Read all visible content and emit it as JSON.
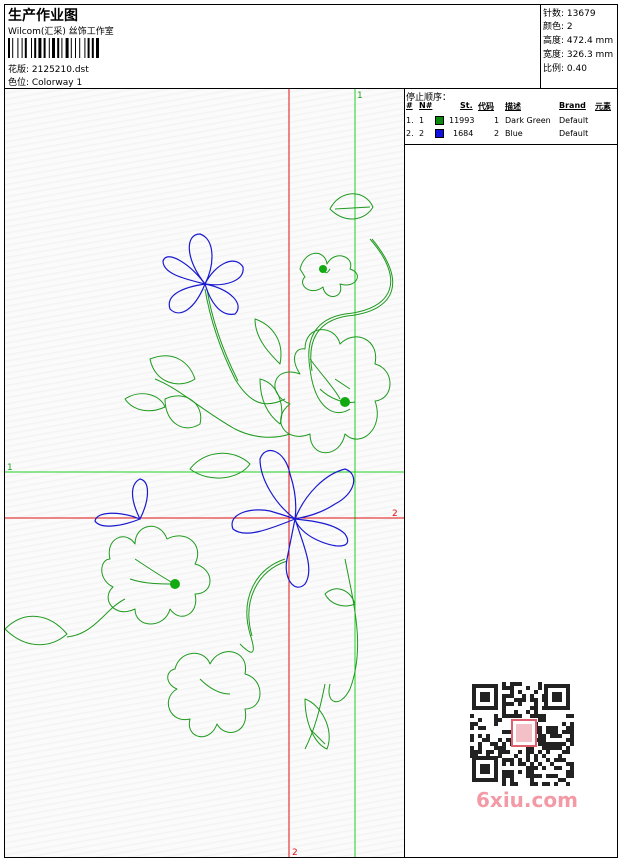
{
  "header": {
    "title": "生产作业图",
    "company": "Wilcom(汇采) 丝饰工作室",
    "design_label": "花版: 2125210.dst",
    "colorway_label": "色位:  Colorway 1"
  },
  "stats": [
    {
      "label": "针数",
      "value": "13679"
    },
    {
      "label": "颜色",
      "value": "2"
    },
    {
      "label": "高度",
      "value": "472.4 mm"
    },
    {
      "label": "宽度",
      "value": "326.3 mm"
    },
    {
      "label": "比例",
      "value": "0.40"
    }
  ],
  "stop_sequence": {
    "title": "停止顺序：",
    "columns": [
      "#",
      "N#",
      "St.",
      "代码",
      "描述",
      "Brand",
      "元素"
    ],
    "rows": [
      {
        "index": "1.",
        "n": "1",
        "stitches": "11993",
        "code": "1",
        "description": "Dark Green",
        "brand": "Default",
        "color": "#0a8a0a"
      },
      {
        "index": "2.",
        "n": "2",
        "stitches": "1684",
        "code": "2",
        "description": "Blue",
        "brand": "Default",
        "color": "#1010e0"
      }
    ]
  },
  "guides": {
    "green_vertical_label": "1",
    "green_horizontal_label": "1",
    "red_horizontal_label": "2",
    "red_vertical_label": "2",
    "green_color": "#1fd11f",
    "red_color": "#e01010"
  },
  "embroidery_colors": {
    "stem": "#1f9a1f",
    "petal": "#1a1ad0"
  },
  "watermark": "6xiu.com"
}
